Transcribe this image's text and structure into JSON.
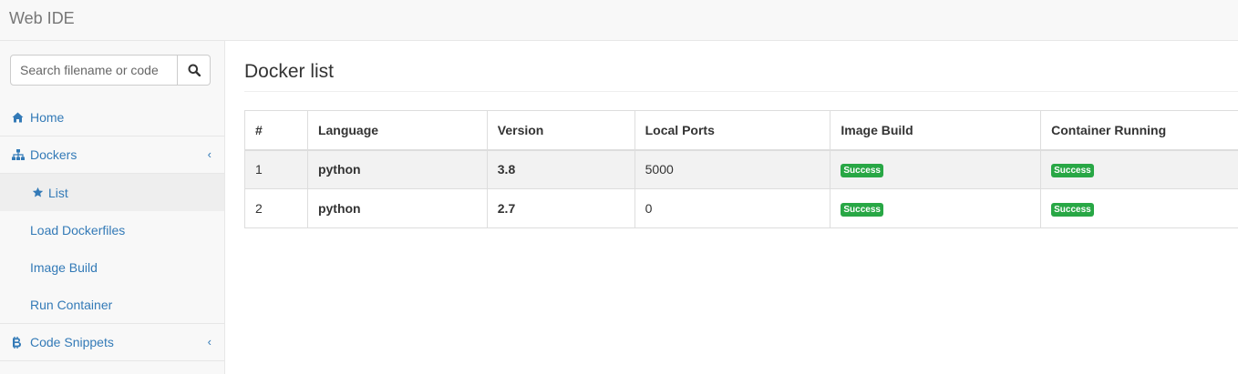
{
  "header": {
    "brand": "Web IDE"
  },
  "sidebar": {
    "search": {
      "placeholder": "Search filename or code"
    },
    "items": [
      {
        "label": "Home",
        "icon": "home-icon"
      },
      {
        "label": "Dockers",
        "icon": "sitemap-icon",
        "expanded": true,
        "children": [
          {
            "label": "List",
            "icon": "star-icon",
            "active": true
          },
          {
            "label": "Load Dockerfiles"
          },
          {
            "label": "Image Build"
          },
          {
            "label": "Run Container"
          }
        ]
      },
      {
        "label": "Code Snippets",
        "icon": "bitcoin-icon"
      }
    ]
  },
  "main": {
    "title": "Docker list",
    "table": {
      "columns": [
        "#",
        "Language",
        "Version",
        "Local Ports",
        "Image Build",
        "Container Running"
      ],
      "rows": [
        {
          "num": "1",
          "language": "python",
          "version": "3.8",
          "ports": "5000",
          "image_build": "Success",
          "container_running": "Success"
        },
        {
          "num": "2",
          "language": "python",
          "version": "2.7",
          "ports": "0",
          "image_build": "Success",
          "container_running": "Success"
        }
      ]
    }
  },
  "colors": {
    "link": "#337ab7",
    "success": "#28a745",
    "sidebar_bg": "#f8f8f8",
    "active_bg": "#eeeeee"
  }
}
